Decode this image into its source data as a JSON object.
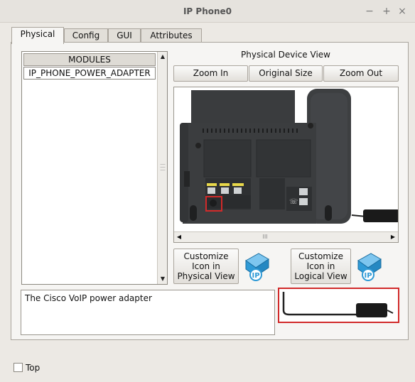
{
  "window": {
    "title": "IP Phone0",
    "controls": {
      "minimize": "−",
      "maximize": "+",
      "close": "×"
    }
  },
  "tabs": [
    "Physical",
    "Config",
    "GUI",
    "Attributes"
  ],
  "active_tab": "Physical",
  "modules": {
    "header": "MODULES",
    "items": [
      "IP_PHONE_POWER_ADAPTER"
    ]
  },
  "physical_view": {
    "title": "Physical Device View",
    "zoom_in": "Zoom In",
    "original_size": "Original Size",
    "zoom_out": "Zoom Out",
    "scroll_grip": "III"
  },
  "customize": {
    "physical": "Customize\nIcon in\nPhysical View",
    "logical": "Customize\nIcon in\nLogical View",
    "icon_label": "IP"
  },
  "description": "The Cisco VoIP power adapter",
  "footer": {
    "top_label": "Top"
  },
  "colors": {
    "highlight": "#d12a2a",
    "phone_body": "#3d3f41",
    "ip_icon": "#2f9ad6"
  }
}
